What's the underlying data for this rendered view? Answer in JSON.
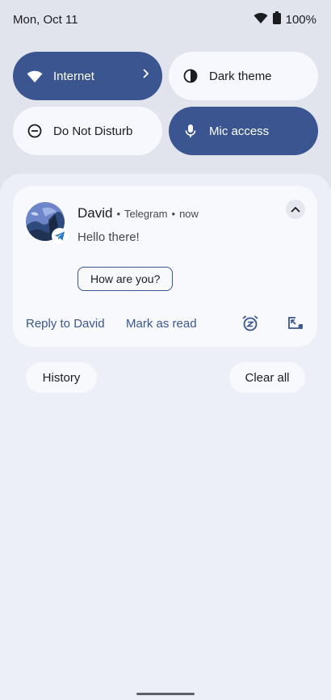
{
  "status_bar": {
    "date": "Mon, Oct 11",
    "battery": "100%",
    "icons": [
      "wifi-icon",
      "battery-icon"
    ]
  },
  "quick_settings": {
    "tiles": [
      {
        "label": "Internet",
        "active": true,
        "icon": "wifi-icon",
        "has_chevron": true
      },
      {
        "label": "Dark theme",
        "active": false,
        "icon": "dark-theme-icon"
      },
      {
        "label": "Do Not Disturb",
        "active": false,
        "icon": "do-not-disturb-icon"
      },
      {
        "label": "Mic access",
        "active": true,
        "icon": "microphone-icon"
      }
    ]
  },
  "notification": {
    "sender": "David",
    "app": "Telegram",
    "time": "now",
    "message": "Hello there!",
    "smart_reply": "How are you?",
    "actions": {
      "reply": "Reply to David",
      "mark_read": "Mark as read"
    },
    "icons": [
      "avatar",
      "telegram-icon",
      "expand-icon",
      "snooze-icon",
      "bubble-icon"
    ]
  },
  "footer": {
    "history": "History",
    "clear_all": "Clear all"
  },
  "colors": {
    "accent": "#3a5590",
    "tile_off": "#f6f8fd",
    "background": "#eceff7",
    "shade": "#e1e4ec"
  }
}
